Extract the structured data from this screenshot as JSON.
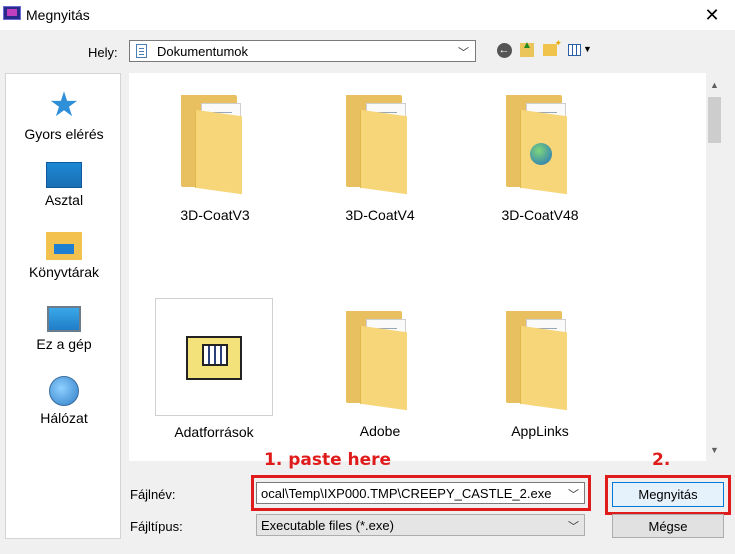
{
  "window": {
    "title": "Megnyitás",
    "close_glyph": "✕"
  },
  "location": {
    "label": "Hely:",
    "value": "Dokumentumok"
  },
  "toolbar": {
    "icons": [
      "back-icon",
      "up-folder-icon",
      "new-folder-icon",
      "view-menu-icon"
    ]
  },
  "places": [
    {
      "label": "Gyors elérés",
      "icon": "quick-access-star-icon"
    },
    {
      "label": "Asztal",
      "icon": "desktop-icon"
    },
    {
      "label": "Könyvtárak",
      "icon": "libraries-icon"
    },
    {
      "label": "Ez a gép",
      "icon": "this-pc-icon"
    },
    {
      "label": "Hálózat",
      "icon": "network-icon"
    }
  ],
  "files": [
    {
      "name": "3D-CoatV3",
      "type": "folder"
    },
    {
      "name": "3D-CoatV4",
      "type": "folder"
    },
    {
      "name": "3D-CoatV48",
      "type": "folder-web"
    },
    {
      "name": "Adatforrások",
      "type": "data-sources"
    },
    {
      "name": "Adobe",
      "type": "folder"
    },
    {
      "name": "AppLinks",
      "type": "folder"
    }
  ],
  "annotations": {
    "step1": "1. paste here",
    "step2": "2."
  },
  "filename": {
    "label": "Fájlnév:",
    "value": "ocal\\Temp\\IXP000.TMP\\CREEPY_CASTLE_2.exe"
  },
  "filetype": {
    "label": "Fájltípus:",
    "value": "Executable files (*.exe)"
  },
  "buttons": {
    "open": "Megnyitás",
    "cancel": "Mégse"
  },
  "colors": {
    "annotation_red": "#e01b1b",
    "folder_yellow": "#e8c05f",
    "accent_blue": "#0078d7"
  }
}
